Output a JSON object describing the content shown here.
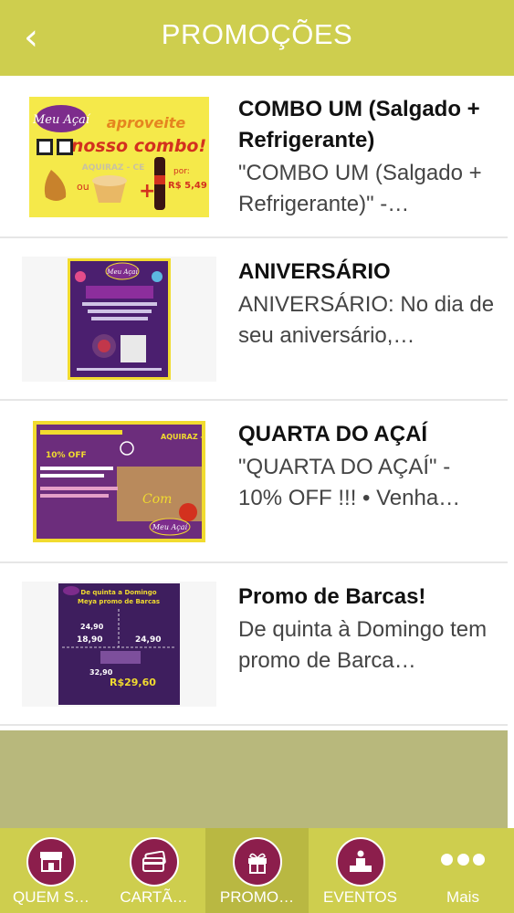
{
  "header": {
    "title": "PROMOÇÕES",
    "back_icon": "chevron-left-icon"
  },
  "promotions": [
    {
      "title": "COMBO UM (Salgado + Refrigerante)",
      "description": "\"COMBO UM (Salgado + Refrigerante)\" -…",
      "image": {
        "brand": "Meu Açaí",
        "headline1": "aproveite",
        "headline2": "nosso combo!",
        "location": "AQUIRAZ - CE",
        "price_label": "por:",
        "price": "R$ 5,49",
        "connector": "ou"
      }
    },
    {
      "title": "ANIVERSÁRIO",
      "description": "ANIVERSÁRIO: No dia de seu aniversário,…",
      "image": {
        "brand": "Meu Açaí"
      }
    },
    {
      "title": "QUARTA DO AÇAÍ",
      "description": "\"QUARTA DO AÇAÍ\" - 10% OFF !!! • Venha…",
      "image": {
        "brand": "Meu Açaí",
        "location": "AQUIRAZ - CE",
        "discount": "10% OFF"
      }
    },
    {
      "title": "Promo de Barcas!",
      "description": "De quinta à Domingo tem promo de Barca…",
      "image": {
        "heading": "De quinta a Domingo",
        "subheading": "Meya promo de Barcas",
        "prices": [
          "24,90",
          "18,90",
          "24,90",
          "32,90",
          "R$29,60"
        ]
      }
    }
  ],
  "tabs": [
    {
      "label": "QUEM S…",
      "icon": "storefront-icon"
    },
    {
      "label": "CARTÃ…",
      "icon": "card-icon"
    },
    {
      "label": "PROMO…",
      "icon": "gift-icon",
      "active": true
    },
    {
      "label": "EVENTOS",
      "icon": "podium-icon"
    },
    {
      "label": "Mais",
      "icon": "more-dots-icon"
    }
  ],
  "colors": {
    "accent": "#CECE4E",
    "tab_active": "#B9B842",
    "icon_bg": "#8C1E4C",
    "filler": "#B8B87C"
  }
}
